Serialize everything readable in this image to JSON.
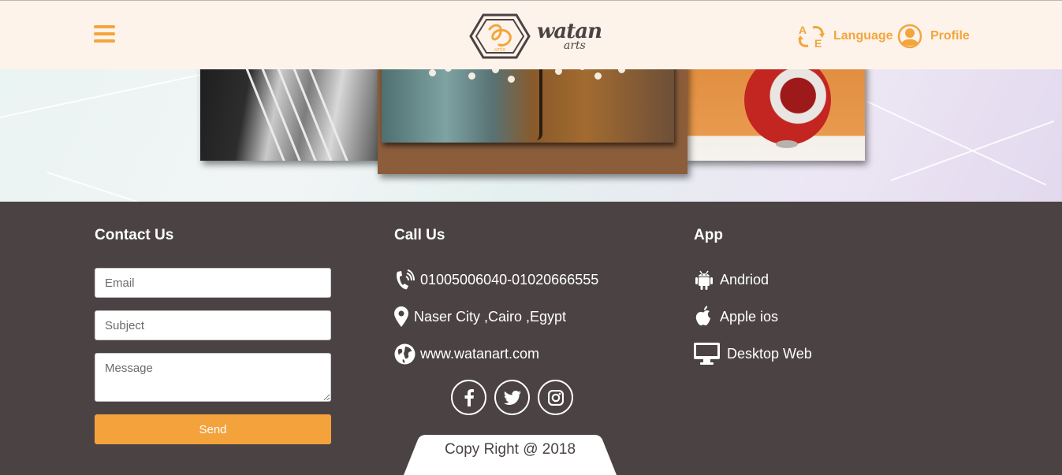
{
  "header": {
    "brand": {
      "name": "watan",
      "sub": "arts",
      "emblem_text": "arts"
    },
    "language_label": "Language",
    "profile_label": "Profile",
    "language_icon_letters": {
      "top": "A",
      "bottom": "E"
    }
  },
  "contact": {
    "title": "Contact Us",
    "email_placeholder": "Email",
    "subject_placeholder": "Subject",
    "message_placeholder": "Message",
    "send_label": "Send"
  },
  "call": {
    "title": "Call Us",
    "phone": "01005006040-01020666555",
    "address": "Naser City ,Cairo ,Egypt",
    "website": "www.watanart.com",
    "social": [
      "facebook-icon",
      "twitter-icon",
      "instagram-icon"
    ]
  },
  "app": {
    "title": "App",
    "items": [
      {
        "label": "Andriod",
        "icon": "android-icon"
      },
      {
        "label": "Apple ios",
        "icon": "apple-icon"
      },
      {
        "label": "Desktop Web",
        "icon": "desktop-icon"
      }
    ]
  },
  "copyright": "Copy Right @ 2018",
  "colors": {
    "accent": "#f3a53c",
    "footer_bg": "#4b4343",
    "header_bg": "#fdf3ea",
    "send_button": "#f4a23c"
  }
}
